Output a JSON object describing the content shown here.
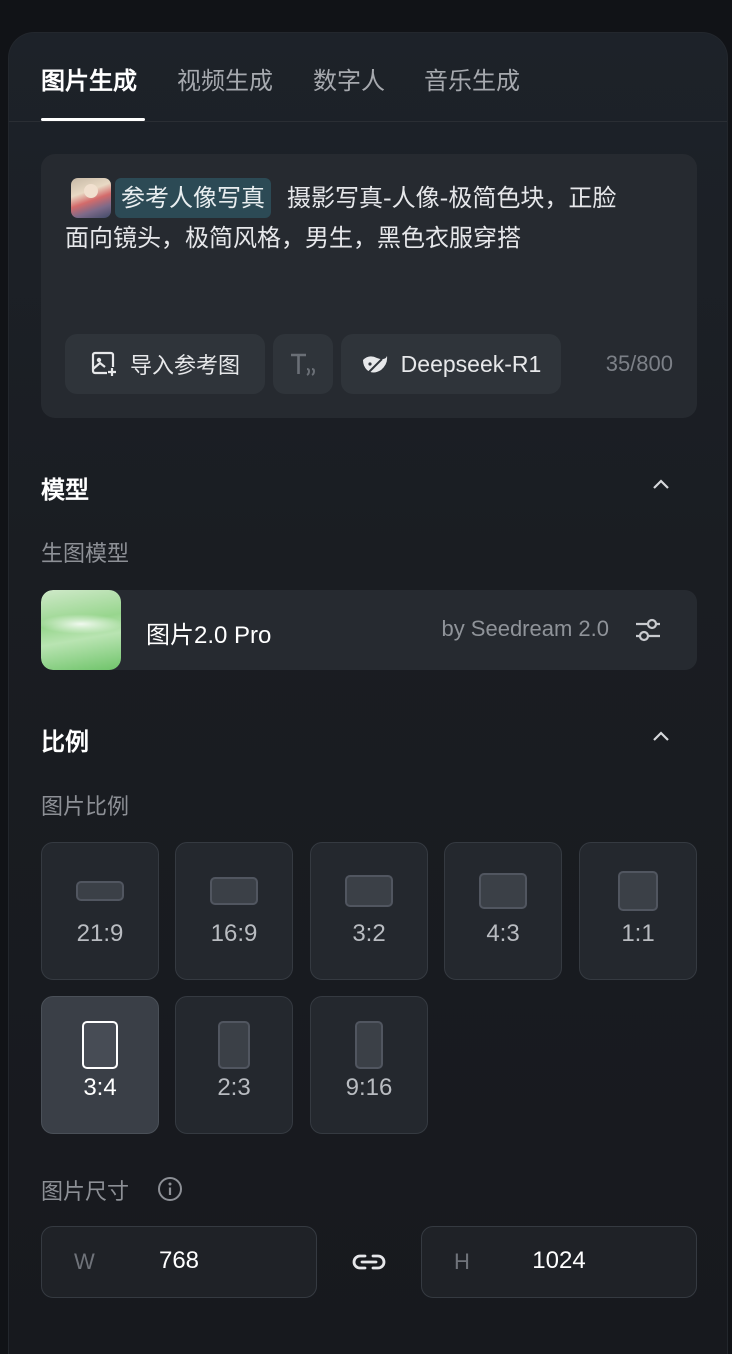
{
  "tabs": [
    {
      "label": "图片生成",
      "active": true
    },
    {
      "label": "视频生成",
      "active": false
    },
    {
      "label": "数字人",
      "active": false
    },
    {
      "label": "音乐生成",
      "active": false
    }
  ],
  "prompt": {
    "ref_chip": "参考人像写真",
    "line1": "摄影写真-人像-极简色块，正脸",
    "line2": "面向镜头，极简风格，男生，黑色衣服穿搭",
    "import_label": "导入参考图",
    "text_tool_icon": "text-format-icon",
    "model_label": "Deepseek-R1",
    "counter": "35/800"
  },
  "model_section": {
    "title": "模型",
    "sub_label": "生图模型",
    "card": {
      "name": "图片2.0 Pro",
      "by": "by Seedream 2.0"
    }
  },
  "ratio_section": {
    "title": "比例",
    "sub_label": "图片比例",
    "options": [
      "21:9",
      "16:9",
      "3:2",
      "4:3",
      "1:1",
      "3:4",
      "2:3",
      "9:16"
    ],
    "selected": "3:4"
  },
  "size_section": {
    "label": "图片尺寸",
    "width_prefix": "W",
    "width": "768",
    "height_prefix": "H",
    "height": "1024"
  },
  "colors": {
    "accent_chip": "#2c4a55",
    "panel_bg": "#1d2229",
    "selected_ratio": "#3a3f47"
  }
}
